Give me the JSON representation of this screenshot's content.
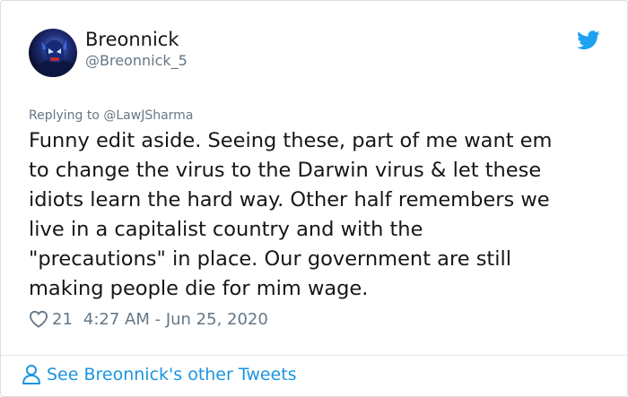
{
  "tweet": {
    "display_name": "Breonnick",
    "handle": "@Breonnick_5",
    "replying_to": "Replying to @LawJSharma",
    "text": "Funny edit aside. Seeing these, part of me want em\nto change the virus to the Darwin virus & let these\nidiots learn the hard way. Other half remembers we\nlive in a capitalist country and with the\n\"precautions\" in place. Our government are still\nmaking people die for mim wage.",
    "likes": "21",
    "timestamp": "4:27 AM - Jun 25, 2020"
  },
  "footer": {
    "link_label": "See Breonnick's other Tweets"
  },
  "icons": {
    "brand": "twitter-bird-icon",
    "like": "heart-icon",
    "profile": "person-icon"
  },
  "colors": {
    "accent": "#1b95e0",
    "secondary_text": "#657786",
    "primary_text": "#14171a"
  }
}
